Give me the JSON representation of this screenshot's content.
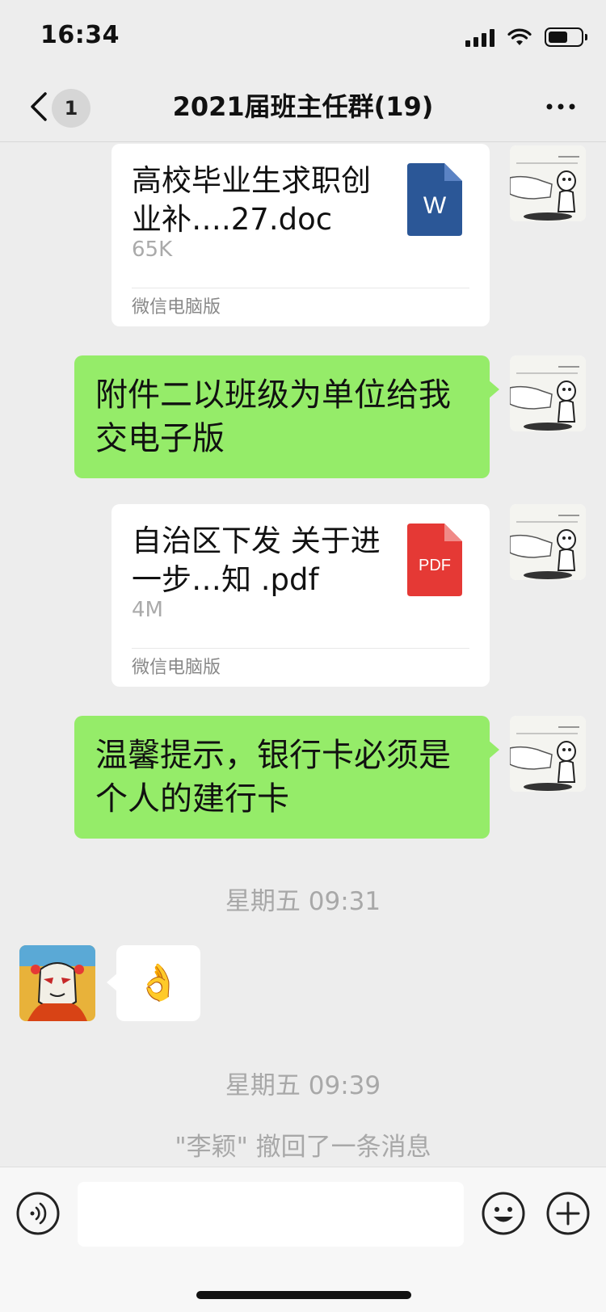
{
  "status_bar": {
    "time": "16:34"
  },
  "nav": {
    "unread_badge": "1",
    "title": "2021届班主任群(19)"
  },
  "messages": [
    {
      "type": "file",
      "file_name": "高校毕业生求职创业补….27.doc",
      "size": "65K",
      "source": "微信电脑版",
      "file_type": "W"
    },
    {
      "type": "text",
      "text": "附件二以班级为单位给我交电子版"
    },
    {
      "type": "file",
      "file_name": "自治区下发  关于进一步…知 .pdf",
      "size": "4M",
      "source": "微信电脑版",
      "file_type": "PDF"
    },
    {
      "type": "text",
      "text": "温馨提示，银行卡必须是个人的建行卡"
    }
  ],
  "time_labels": [
    "星期五 09:31",
    "星期五 09:39"
  ],
  "incoming": {
    "emoji": "👌"
  },
  "recall_note": "\"李颖\" 撤回了一条消息",
  "colors": {
    "accent_green": "#95ec69",
    "word_blue": "#2b5797",
    "pdf_red": "#e53935"
  }
}
